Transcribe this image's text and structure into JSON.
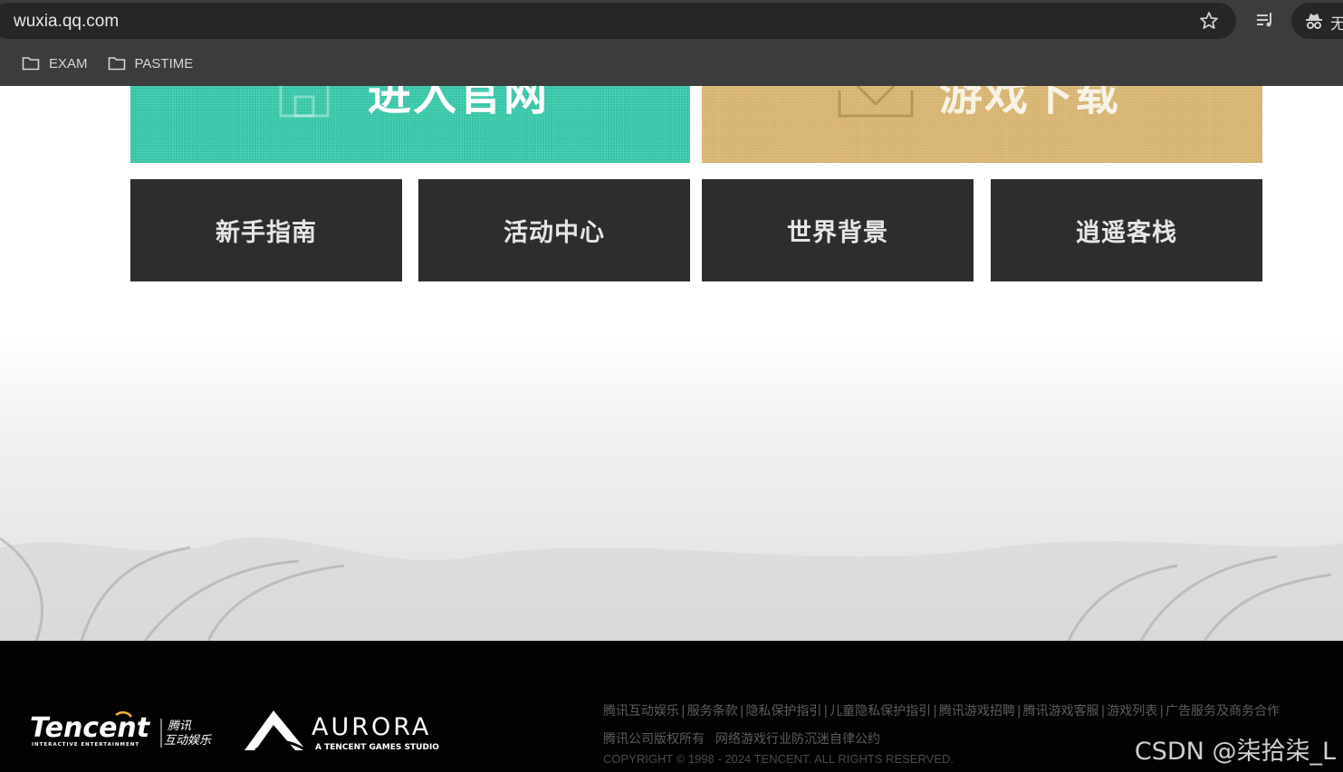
{
  "browser": {
    "url": "wuxia.qq.com",
    "profile_label": "无",
    "bookmarks": [
      {
        "label": "EXAM",
        "icon": "folder-icon"
      },
      {
        "label": "PASTIME",
        "icon": "folder-icon"
      }
    ],
    "icons": [
      "star-icon",
      "media-control-icon",
      "incognito-icon"
    ]
  },
  "page": {
    "big_buttons": [
      {
        "label": "进入官网",
        "icon": "home-icon",
        "color": "#33c5a6"
      },
      {
        "label": "游戏下载",
        "icon": "download-icon",
        "color": "#d6b26c"
      }
    ],
    "nav_tiles": [
      "新手指南",
      "活动中心",
      "世界背景",
      "逍遥客栈"
    ]
  },
  "footer": {
    "logos": [
      {
        "name": "Tencent",
        "sub": "INTERACTIVE ENTERTAINMENT",
        "cn": "腾讯互动娱乐"
      },
      {
        "name": "AURORA",
        "sub": "A TENCENT GAMES STUDIO"
      }
    ],
    "links": [
      "腾讯互动娱乐",
      "服务条款",
      "隐私保护指引",
      "儿童隐私保护指引",
      "腾讯游戏招聘",
      "腾讯游戏客服",
      "游戏列表",
      "广告服务及商务合作"
    ],
    "line2": [
      "腾讯公司版权所有",
      "网络游戏行业防沉迷自律公约"
    ],
    "copyright": "COPYRIGHT © 1998 - 2024 TENCENT. ALL RIGHTS RESERVED."
  },
  "watermark": "CSDN @柒拾柒_L"
}
